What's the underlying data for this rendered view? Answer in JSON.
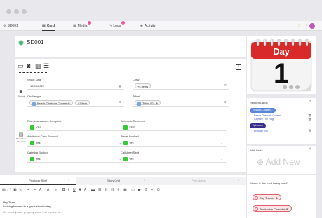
{
  "tabs": [
    {
      "label": "SD001",
      "icon": "settings-icon"
    },
    {
      "label": "Card",
      "icon": "card-icon"
    },
    {
      "label": "Media",
      "icon": "media-icon",
      "badge": true
    },
    {
      "label": "Logs",
      "icon": "clock-icon",
      "badge": true
    },
    {
      "label": "Activity",
      "icon": "activity-icon"
    }
  ],
  "title": "SD001",
  "form": {
    "shoot_date_label": "Shoot Date",
    "shoot_date_value": "17/03/2022",
    "crew_label": "Crew",
    "crew_value": "+4 items",
    "challenges_label": "Challenges",
    "challenge_item": "Beach Obstacle Course",
    "challenge_more": "+1 item",
    "tribal_label": "Tribal",
    "tribal_item": "Tribal 001",
    "shoot_side_label": "Shoot",
    "risk_label": "Risk Assessment Complete",
    "risk_value": "YES",
    "schedule_label": "Schedule Received",
    "schedule_value": "YES",
    "add_crew_label": "Additional Crew Booked",
    "add_crew_value": "Yes",
    "travel_label": "Travel Booked",
    "travel_value": "Yes",
    "catering_label": "Catering Booked",
    "catering_value": "Yes",
    "callsheet_label": "Callsheet Sent",
    "callsheet_value": "Yes",
    "checklist_side_label": "Production Checklist"
  },
  "calendar": {
    "month": "Day",
    "date": "1"
  },
  "related": {
    "heading": "Related Cards",
    "items": [
      {
        "pill": "Related Challen...",
        "links": [
          "Beach Obstacle Course",
          "Capture The Flag"
        ],
        "color": "#5a86d8"
      },
      {
        "pill": "Episodes",
        "links": [
          "Episode 001"
        ],
        "color": "#3a2e8c"
      }
    ]
  },
  "weblinks": {
    "heading": "Web Links",
    "add_label": "Add New"
  },
  "bottom_tabs": [
    "Producer Brief",
    "Story Grid",
    "Post Notes"
  ],
  "editor": {
    "lines": [
      "Hey Team,",
      "Looking forward to a great shoot today!",
      "We know you've properly shoot it in a guide to..."
    ]
  },
  "usage": {
    "heading": "Where is this card being used?",
    "items": [
      "Day Tracker",
      "Production Checklist"
    ]
  },
  "colors": {
    "accent_green": "#33cc33",
    "calendar_red": "#d82a2a",
    "pink": "#e05aa0"
  }
}
